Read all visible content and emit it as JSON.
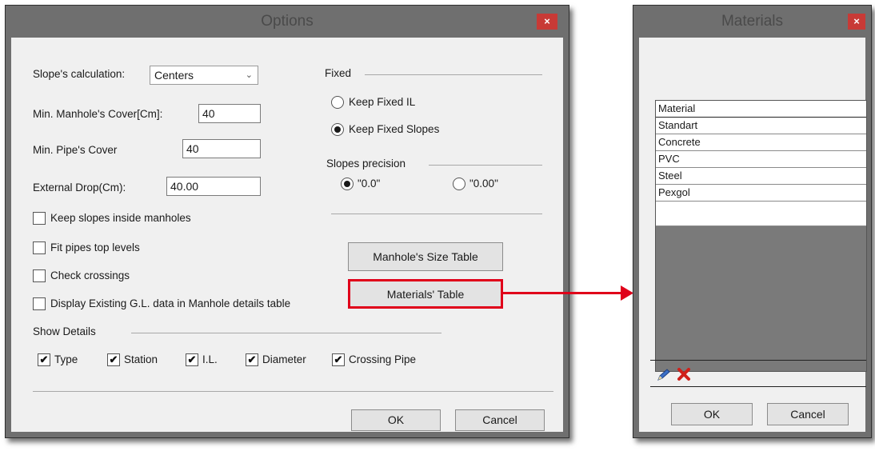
{
  "options": {
    "title": "Options",
    "close": "×",
    "slope_calc_label": "Slope's calculation:",
    "slope_calc_value": "Centers",
    "min_manhole_cover_label": "Min. Manhole's Cover[Cm]:",
    "min_manhole_cover_value": "40",
    "min_pipe_cover_label": "Min. Pipe's Cover",
    "min_pipe_cover_value": "40",
    "external_drop_label": "External Drop(Cm):",
    "external_drop_value": "40.00",
    "checkboxes": [
      {
        "label": "Keep slopes inside manholes",
        "checked": false
      },
      {
        "label": "Fit pipes top levels",
        "checked": false
      },
      {
        "label": "Check crossings",
        "checked": false
      },
      {
        "label": "Display Existing G.L. data in Manhole details table",
        "checked": false
      }
    ],
    "fixed_group": "Fixed",
    "keep_fixed_il": "Keep Fixed IL",
    "keep_fixed_slopes": "Keep Fixed Slopes",
    "slopes_precision": "Slopes precision",
    "precision_1": "\"0.0\"",
    "precision_2": "\"0.00\"",
    "manhole_size_button": "Manhole's Size Table",
    "materials_button": "Materials' Table",
    "show_details": "Show Details",
    "details": [
      {
        "label": "Type",
        "checked": true
      },
      {
        "label": "Station",
        "checked": true
      },
      {
        "label": "I.L.",
        "checked": true
      },
      {
        "label": "Diameter",
        "checked": true
      },
      {
        "label": "Crossing Pipe",
        "checked": true
      }
    ],
    "ok": "OK",
    "cancel": "Cancel",
    "highlight_color": "#e0001a"
  },
  "materials": {
    "title": "Materials",
    "close": "×",
    "header": "Material",
    "rows": [
      "Standart",
      "Concrete",
      "PVC",
      "Steel",
      "Pexgol",
      ""
    ],
    "edit_icon": "pencil-icon",
    "delete_icon": "red-x-icon",
    "ok": "OK",
    "cancel": "Cancel"
  }
}
